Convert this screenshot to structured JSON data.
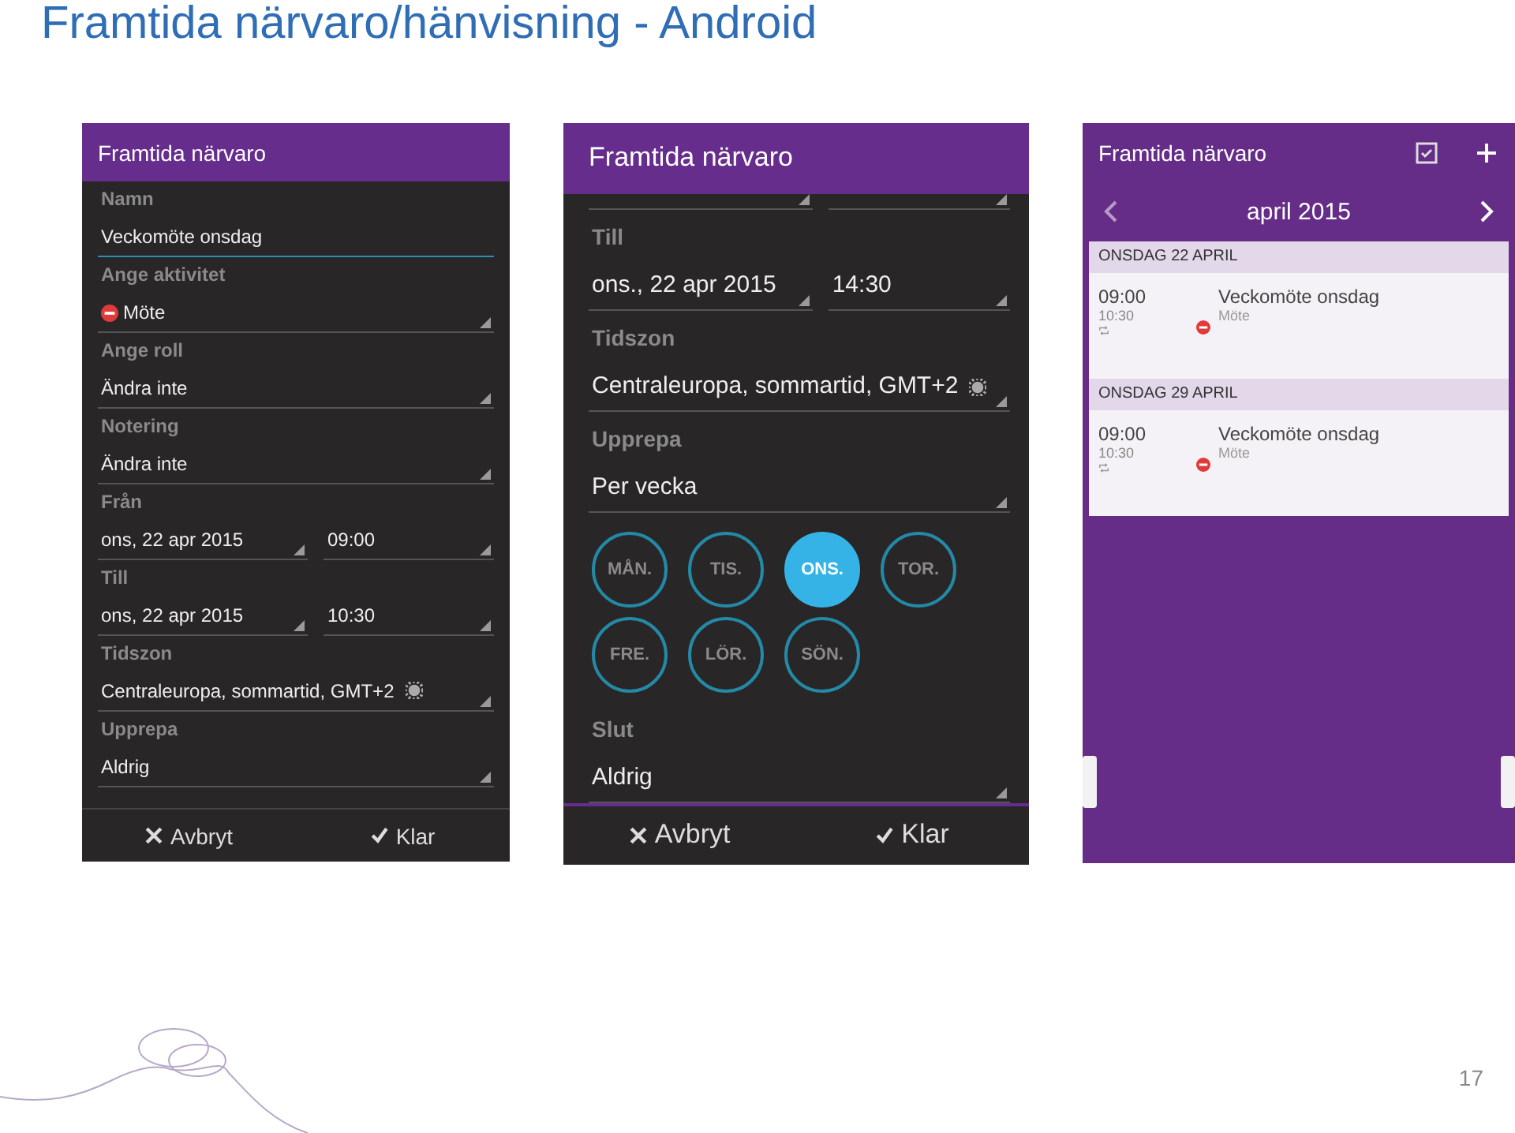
{
  "title": "Framtida närvaro/hänvisning - Android",
  "phones": [
    {
      "kind": "form",
      "title": "Framtida närvaro",
      "fields": [
        {
          "kind": "text",
          "label": "Namn",
          "values": [
            "Veckomöte onsdag"
          ]
        },
        {
          "kind": "activity",
          "label": "Ange aktivitet",
          "values": [
            "Möte"
          ]
        },
        {
          "kind": "select",
          "label": "Ange roll",
          "values": [
            "Ändra inte"
          ]
        },
        {
          "kind": "select",
          "label": "Notering",
          "values": [
            "Ändra inte"
          ]
        },
        {
          "kind": "pair",
          "label": "Från",
          "values": [
            "ons, 22 apr 2015",
            "09:00"
          ]
        },
        {
          "kind": "pair",
          "label": "Till",
          "values": [
            "ons, 22 apr 2015",
            "10:30"
          ]
        },
        {
          "kind": "timezone",
          "label": "Tidszon",
          "values": [
            "Centraleuropa, sommartid, GMT+2"
          ]
        },
        {
          "kind": "select",
          "label": "Upprepa",
          "values": [
            "Aldrig"
          ]
        }
      ],
      "actions": [
        {
          "kind": "cancel",
          "label": "Avbryt"
        },
        {
          "kind": "done",
          "label": "Klar"
        }
      ]
    },
    {
      "kind": "form",
      "title": "Framtida närvaro",
      "fields": [
        {
          "kind": "cut_pair"
        },
        {
          "kind": "pair",
          "label": "Till",
          "values": [
            "ons., 22 apr 2015",
            "14:30"
          ]
        },
        {
          "kind": "timezone",
          "label": "Tidszon",
          "values": [
            "Centraleuropa, sommartid, GMT+2"
          ]
        },
        {
          "kind": "select",
          "label": "Upprepa",
          "values": [
            "Per vecka"
          ]
        },
        {
          "kind": "days",
          "days": [
            {
              "label": "MÅN.",
              "selected": false
            },
            {
              "label": "TIS.",
              "selected": false
            },
            {
              "label": "ONS.",
              "selected": true
            },
            {
              "label": "TOR.",
              "selected": false
            },
            {
              "label": "FRE.",
              "selected": false
            },
            {
              "label": "LÖR.",
              "selected": false
            },
            {
              "label": "SÖN.",
              "selected": false
            }
          ]
        },
        {
          "kind": "select",
          "label": "Slut",
          "values": [
            "Aldrig"
          ]
        }
      ],
      "actions": [
        {
          "kind": "cancel",
          "label": "Avbryt"
        },
        {
          "kind": "done",
          "label": "Klar"
        }
      ]
    },
    {
      "kind": "list",
      "title": "Framtida närvaro",
      "month": "april 2015",
      "sections": [
        {
          "heading": "ONSDAG 22 APRIL",
          "events": [
            {
              "start": "09:00",
              "end": "10:30",
              "title": "Veckomöte onsdag",
              "activity": "Möte"
            }
          ]
        },
        {
          "heading": "ONSDAG 29 APRIL",
          "events": [
            {
              "start": "09:00",
              "end": "10:30",
              "title": "Veckomöte onsdag",
              "activity": "Möte"
            }
          ]
        }
      ]
    }
  ],
  "page_number": "17"
}
